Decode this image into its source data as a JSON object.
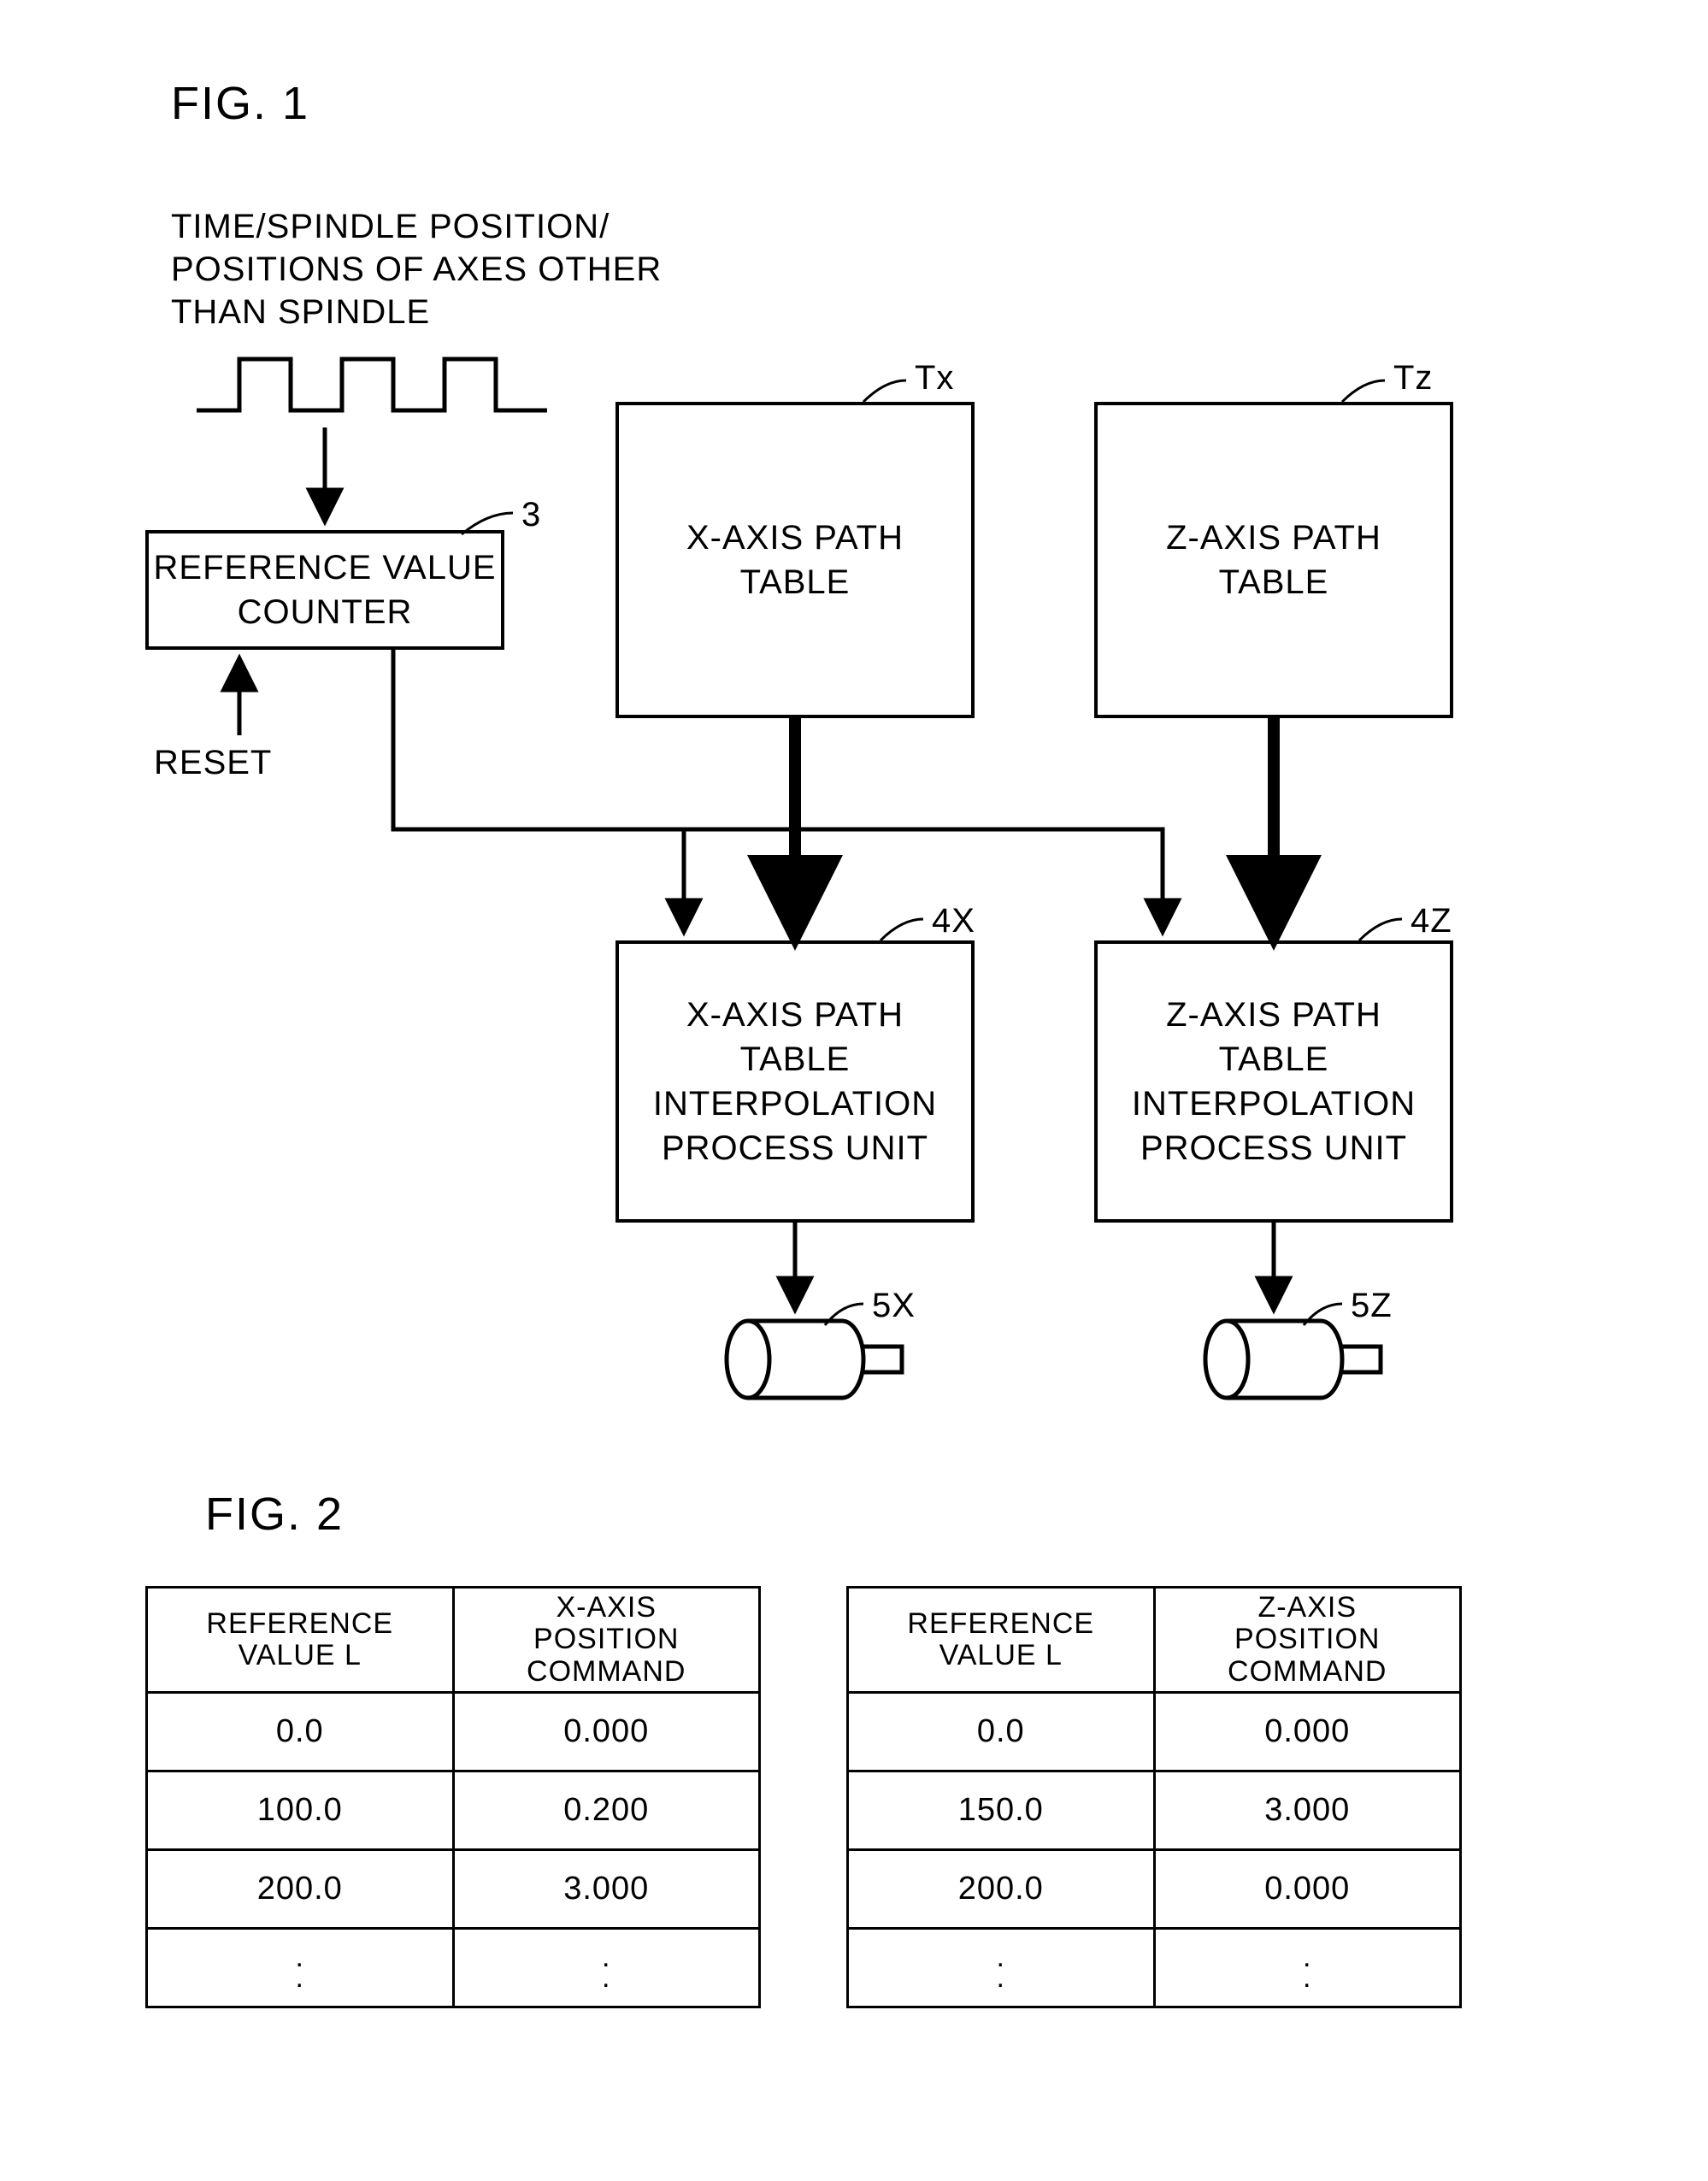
{
  "fig1": {
    "title": "FIG. 1",
    "input_label": "TIME/SPINDLE POSITION/\nPOSITIONS OF AXES OTHER\nTHAN SPINDLE",
    "counter_tag": "3",
    "counter_label": "REFERENCE VALUE\nCOUNTER",
    "reset_label": "RESET",
    "x_table_tag": "Tx",
    "x_table_label": "X-AXIS PATH\nTABLE",
    "z_table_tag": "Tz",
    "z_table_label": "Z-AXIS PATH\nTABLE",
    "x_interp_tag": "4X",
    "x_interp_label": "X-AXIS PATH\nTABLE\nINTERPOLATION\nPROCESS UNIT",
    "z_interp_tag": "4Z",
    "z_interp_label": "Z-AXIS PATH\nTABLE\nINTERPOLATION\nPROCESS UNIT",
    "x_motor_tag": "5X",
    "z_motor_tag": "5Z"
  },
  "fig2": {
    "title": "FIG. 2",
    "table_x": {
      "headers": [
        "REFERENCE\nVALUE L",
        "X-AXIS\nPOSITION\nCOMMAND"
      ],
      "rows": [
        [
          "0.0",
          "0.000"
        ],
        [
          "100.0",
          "0.200"
        ],
        [
          "200.0",
          "3.000"
        ]
      ]
    },
    "table_z": {
      "headers": [
        "REFERENCE\nVALUE L",
        "Z-AXIS\nPOSITION\nCOMMAND"
      ],
      "rows": [
        [
          "0.0",
          "0.000"
        ],
        [
          "150.0",
          "3.000"
        ],
        [
          "200.0",
          "0.000"
        ]
      ]
    }
  },
  "chart_data": [
    {
      "type": "table",
      "title": "X-axis path table",
      "columns": [
        "REFERENCE VALUE L",
        "X-AXIS POSITION COMMAND"
      ],
      "rows": [
        [
          0.0,
          0.0
        ],
        [
          100.0,
          0.2
        ],
        [
          200.0,
          3.0
        ]
      ]
    },
    {
      "type": "table",
      "title": "Z-axis path table",
      "columns": [
        "REFERENCE VALUE L",
        "Z-AXIS POSITION COMMAND"
      ],
      "rows": [
        [
          0.0,
          0.0
        ],
        [
          150.0,
          3.0
        ],
        [
          200.0,
          0.0
        ]
      ]
    }
  ]
}
